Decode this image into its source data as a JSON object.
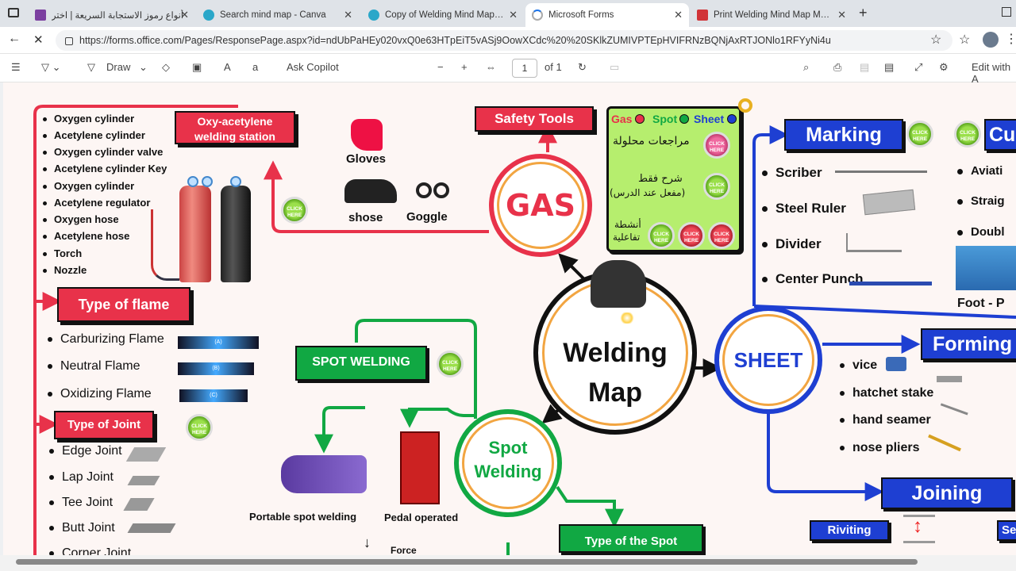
{
  "browser": {
    "tabs": [
      {
        "title": "أنواع رموز الاستجابة السريعة | اختر",
        "color": "#7b3fa0"
      },
      {
        "title": "Search mind map - Canva",
        "color": "#2aa7c9"
      },
      {
        "title": "Copy of Welding Mind Map | MO",
        "color": "#2aa7c9"
      },
      {
        "title": "Microsoft Forms",
        "color": "#ffffff"
      },
      {
        "title": "Print Welding Mind Map MOHAM",
        "color": "#d13438"
      }
    ],
    "url": "https://forms.office.com/Pages/ResponsePage.aspx?id=ndUbPaHEy020vxQ0e63HTpEiT5vASj9OowXCdc%20%20SKlkZUMIVPTEpHVIFRNzBQNjAxRTJONlo1RFYyNi4u"
  },
  "pdf_toolbar": {
    "draw": "Draw",
    "ask": "Ask Copilot",
    "page": "1",
    "of": "of 1",
    "edit": "Edit with A"
  },
  "map": {
    "center": {
      "line1": "Welding",
      "line2": "Map"
    },
    "oxy": {
      "title1": "Oxy-acetylene",
      "title2": "welding station",
      "items": [
        "Oxygen cylinder",
        "Acetylene cylinder",
        "Oxygen cylinder valve",
        "Acetylene cylinder Key",
        "Oxygen cylinder",
        "Acetylene regulator",
        "Oxygen hose",
        "Acetylene hose",
        "Torch",
        "Nozzle"
      ]
    },
    "flame": {
      "title": "Type of flame",
      "items": [
        "Carburizing Flame",
        "Neutral Flame",
        "Oxidizing Flame"
      ],
      "tags": [
        "(A)",
        "(B)",
        "(C)"
      ]
    },
    "joint": {
      "title": "Type of Joint",
      "items": [
        "Edge Joint",
        "Lap Joint",
        "Tee Joint",
        "Butt Joint",
        "Corner Joint"
      ]
    },
    "gas": {
      "label": "GAS"
    },
    "safety": {
      "title": "Safety Tools",
      "gloves": "Gloves",
      "shoes": "shose",
      "goggle": "Goggle"
    },
    "legend": {
      "gas": "Gas",
      "spot": "Spot",
      "sheet": "Sheet",
      "row1": "مراجعات محلولة",
      "row2a": "شرح فقط",
      "row2b": "(مفعل عند الدرس)",
      "row3a": "أنشطة",
      "row3b": "تفاعلية"
    },
    "click": {
      "l1": "CLICK",
      "l2": "HERE"
    },
    "spot": {
      "title": "SPOT WELDING",
      "circle1": "Spot",
      "circle2": "Welding",
      "portable": "Portable spot welding",
      "pedal": "Pedal operated",
      "type": "Type of the Spot",
      "force": "Force"
    },
    "sheet": {
      "label": "SHEET"
    },
    "marking": {
      "title": "Marking",
      "items": [
        "Scriber",
        "Steel Ruler",
        "Divider",
        "Center Punch"
      ]
    },
    "cutting": {
      "title": "Cu",
      "items": [
        "Aviati",
        "Straig",
        "Doubl"
      ],
      "foot": "Foot - P"
    },
    "forming": {
      "title": "Forming",
      "items": [
        "vice",
        "hatchet stake",
        "hand seamer",
        "nose pliers"
      ]
    },
    "joining": {
      "title": "Joining",
      "riveting": "Riviting",
      "se": "Se"
    }
  }
}
